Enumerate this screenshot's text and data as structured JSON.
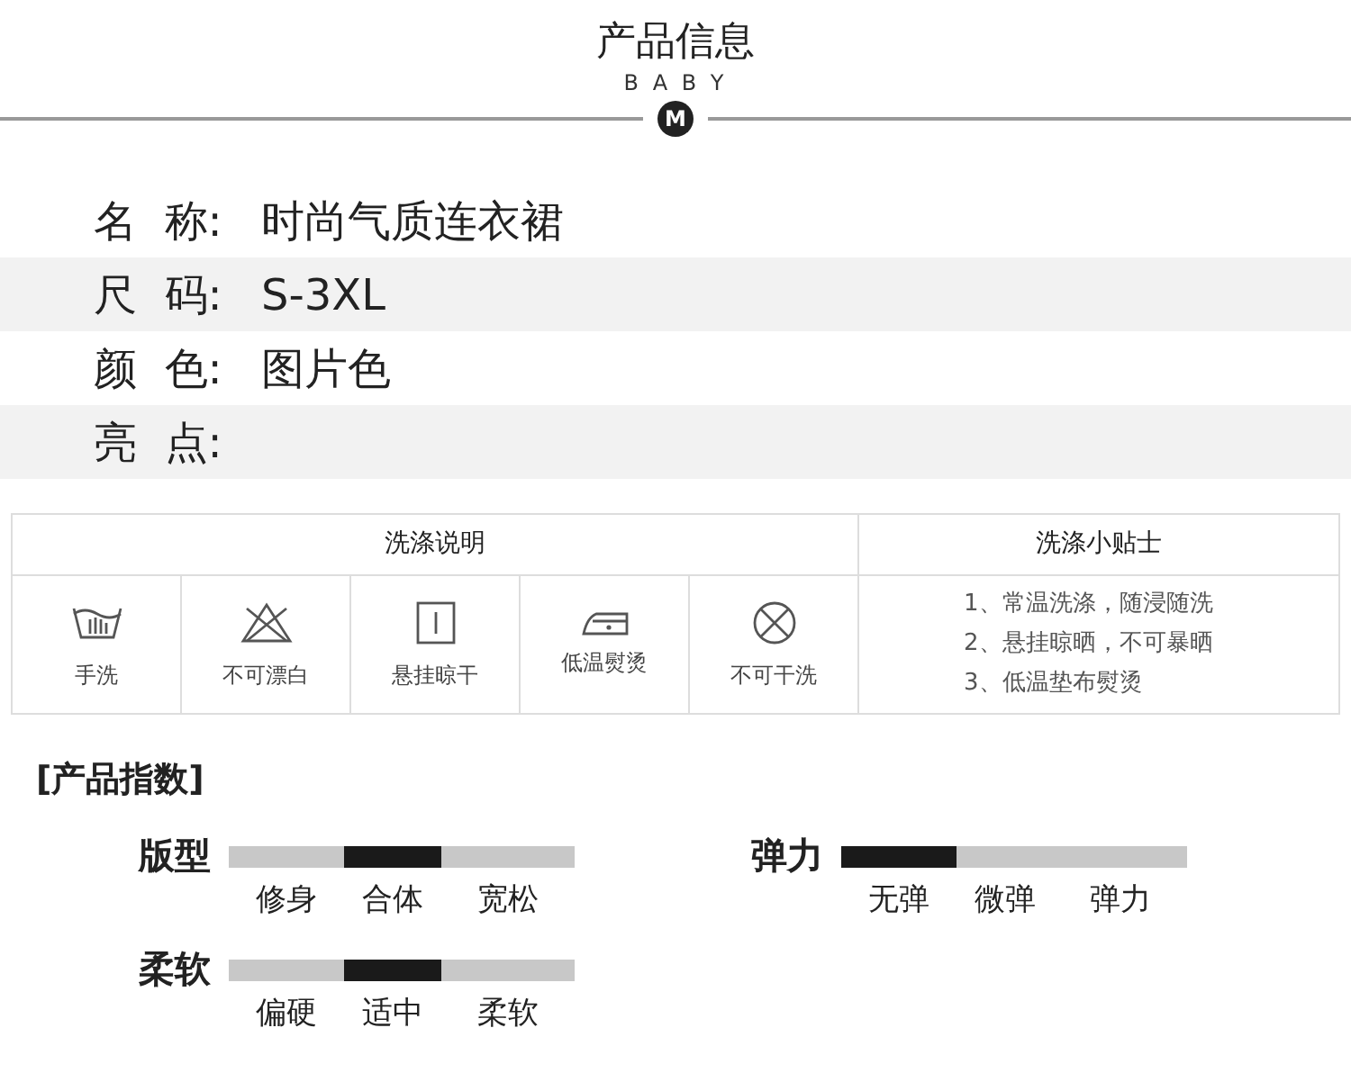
{
  "header": {
    "title": "产品信息",
    "subtitle": "B A B Y",
    "badge": "M"
  },
  "info": [
    {
      "label": "名  称:",
      "value": "时尚气质连衣裙",
      "shaded": false
    },
    {
      "label": "尺  码:",
      "value": "S-3XL",
      "shaded": true
    },
    {
      "label": "颜  色:",
      "value": "图片色",
      "shaded": false
    },
    {
      "label": "亮  点:",
      "shaded": true
    }
  ],
  "care": {
    "title": "洗涤说明",
    "items": [
      {
        "kind": "handwash",
        "label": "手洗"
      },
      {
        "kind": "nobleach",
        "label": "不可漂白"
      },
      {
        "kind": "hangdry",
        "label": "悬挂晾干"
      },
      {
        "kind": "lowiron",
        "label": "低温熨烫"
      },
      {
        "kind": "nodryclean",
        "label": "不可干洗"
      }
    ],
    "tips_title": "洗涤小贴士",
    "tips": [
      "1、常温洗涤，随浸随洗",
      "2、悬挂晾晒，不可暴晒",
      "3、低温垫布熨烫"
    ]
  },
  "index": {
    "title": "[产品指数]",
    "rows": [
      {
        "name": "版型",
        "options": [
          {
            "label": "修身",
            "selected": false
          },
          {
            "label": "合体",
            "selected": true
          },
          {
            "label": "宽松",
            "selected": false
          }
        ]
      },
      {
        "name": "弹力",
        "options": [
          {
            "label": "无弹",
            "selected": true
          },
          {
            "label": "微弹",
            "selected": false
          },
          {
            "label": "弹力",
            "selected": false
          }
        ]
      },
      {
        "name": "柔软",
        "options": [
          {
            "label": "偏硬",
            "selected": false
          },
          {
            "label": "适中",
            "selected": true
          },
          {
            "label": "柔软",
            "selected": false
          }
        ]
      }
    ]
  }
}
